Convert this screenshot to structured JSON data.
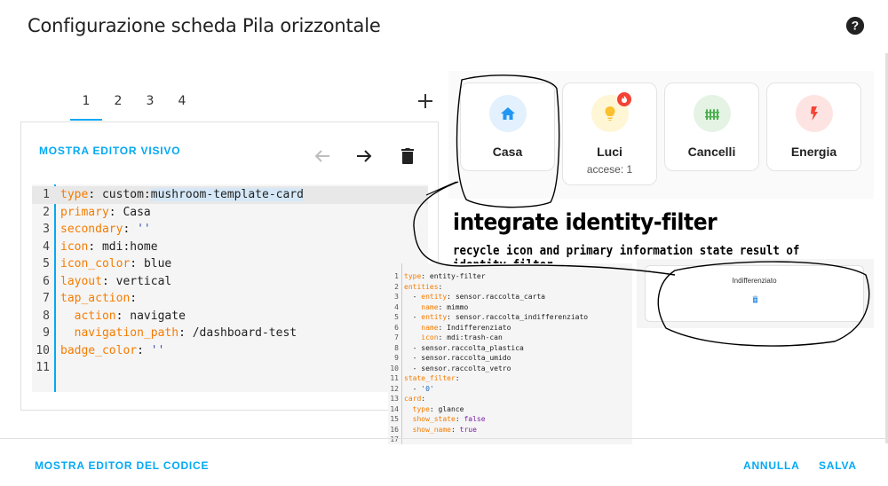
{
  "dialog": {
    "title": "Configurazione scheda Pila orizzontale",
    "help_icon": "help-circle-icon"
  },
  "tabs": [
    {
      "label": "1",
      "active": true
    },
    {
      "label": "2",
      "active": false
    },
    {
      "label": "3",
      "active": false
    },
    {
      "label": "4",
      "active": false
    }
  ],
  "toolbar": {
    "show_visual_editor": "MOSTRA EDITOR VISIVO",
    "move_left_icon": "arrow-left-icon",
    "move_right_icon": "arrow-right-icon",
    "delete_icon": "trash-icon",
    "add_icon": "plus-icon"
  },
  "code_editor": {
    "lines": [
      {
        "n": "1",
        "key": "type",
        "value": "custom:mushroom-template-card"
      },
      {
        "n": "2",
        "key": "primary",
        "value": "Casa"
      },
      {
        "n": "3",
        "key": "secondary",
        "value": "''"
      },
      {
        "n": "4",
        "key": "icon",
        "value": "mdi:home"
      },
      {
        "n": "5",
        "key": "icon_color",
        "value": "blue"
      },
      {
        "n": "6",
        "key": "layout",
        "value": "vertical"
      },
      {
        "n": "7",
        "key": "tap_action",
        "value": ""
      },
      {
        "n": "8",
        "key": "action",
        "value": "navigate"
      },
      {
        "n": "9",
        "key": "navigation_path",
        "value": "/dashboard-test"
      },
      {
        "n": "10",
        "key": "badge_color",
        "value": "''"
      },
      {
        "n": "11",
        "key": "",
        "value": ""
      }
    ]
  },
  "preview_cards": [
    {
      "name": "Casa",
      "secondary": "",
      "icon": "home-icon",
      "color": "#2196f3",
      "bg": "#e3f0fd"
    },
    {
      "name": "Luci",
      "secondary": "accese: 1",
      "icon": "lightbulb-icon",
      "color": "#fbc02d",
      "bg": "#fff6d6",
      "badge": "fire-icon"
    },
    {
      "name": "Cancelli",
      "secondary": "",
      "icon": "fence-icon",
      "color": "#4caf50",
      "bg": "#e4f3e4"
    },
    {
      "name": "Energia",
      "secondary": "",
      "icon": "flash-icon",
      "color": "#f44336",
      "bg": "#fde4e2"
    }
  ],
  "annotation": {
    "title": "integrate identity-filter",
    "subtitle": "recycle icon and primary information state result of identity filter"
  },
  "yaml_snippet": {
    "lines": [
      {
        "n": "1",
        "text": "type: entity-filter"
      },
      {
        "n": "2",
        "text": "entities:"
      },
      {
        "n": "3",
        "text": "  - entity: sensor.raccolta_carta"
      },
      {
        "n": "4",
        "text": "    name: mimmo"
      },
      {
        "n": "5",
        "text": "  - entity: sensor.raccolta_indifferenziato"
      },
      {
        "n": "6",
        "text": "    name: Indifferenziato"
      },
      {
        "n": "7",
        "text": "    icon: mdi:trash-can"
      },
      {
        "n": "8",
        "text": "  - sensor.raccolta_plastica"
      },
      {
        "n": "9",
        "text": "  - sensor.raccolta_umido"
      },
      {
        "n": "10",
        "text": "  - sensor.raccolta_vetro"
      },
      {
        "n": "11",
        "text": "state_filter:"
      },
      {
        "n": "12",
        "text": "  - '0'"
      },
      {
        "n": "13",
        "text": "card:"
      },
      {
        "n": "14",
        "text": "  type: glance"
      },
      {
        "n": "15",
        "text": "  show_state: false"
      },
      {
        "n": "16",
        "text": "  show_name: true"
      },
      {
        "n": "17",
        "text": ""
      }
    ]
  },
  "glance_preview": {
    "name": "Indifferenziato",
    "icon": "trash-can-icon"
  },
  "footer": {
    "show_code_editor": "MOSTRA EDITOR DEL CODICE",
    "cancel": "ANNULLA",
    "save": "SALVA"
  },
  "colors": {
    "accent": "#03a9f4"
  }
}
